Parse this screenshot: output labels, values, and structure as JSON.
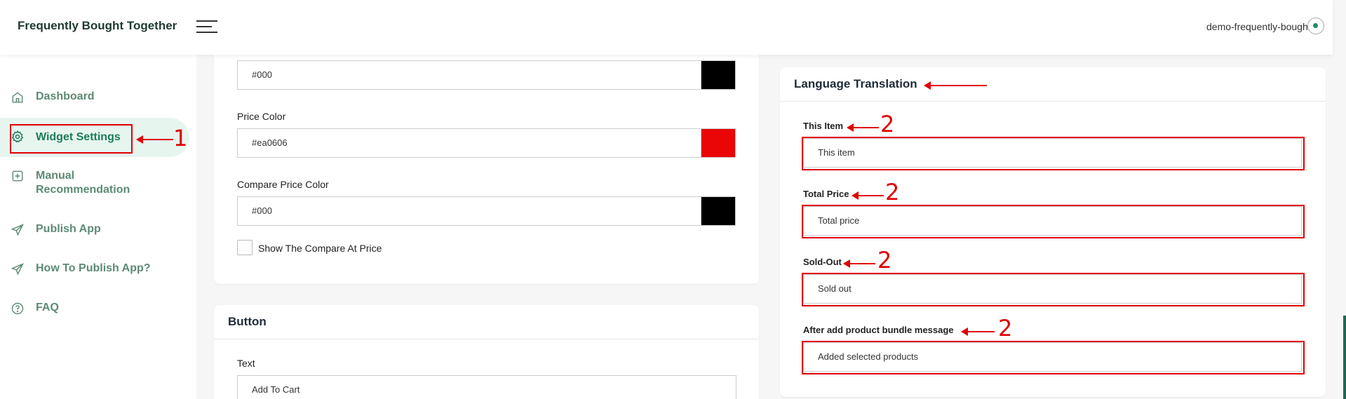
{
  "app": {
    "title": "Frequently Bought Together",
    "store": "demo-frequently-bought"
  },
  "sidebar": {
    "items": [
      {
        "label": "Dashboard",
        "icon": "home-icon"
      },
      {
        "label": "Widget Settings",
        "icon": "gear-icon"
      },
      {
        "label": "Manual Recommendation",
        "icon": "plus-square-icon"
      },
      {
        "label": "Publish App",
        "icon": "send-icon"
      },
      {
        "label": "How To Publish App?",
        "icon": "send-icon"
      },
      {
        "label": "FAQ",
        "icon": "question-circle-icon"
      }
    ]
  },
  "annotations": {
    "n1": "1",
    "n2": "2"
  },
  "colors_panel": {
    "top_value": "#000",
    "price_color_label": "Price Color",
    "price_color_value": "#ea0606",
    "compare_price_label": "Compare Price Color",
    "compare_price_value": "#000",
    "show_compare_label": "Show The Compare At Price",
    "swatch_colors": [
      "#000000",
      "#ea0606",
      "#000000"
    ]
  },
  "button_panel": {
    "title": "Button",
    "text_label": "Text",
    "text_value": "Add To Cart"
  },
  "language_panel": {
    "title": "Language Translation",
    "fields": [
      {
        "label": "This Item",
        "value": "This item"
      },
      {
        "label": "Total Price",
        "value": "Total price"
      },
      {
        "label": "Sold-Out",
        "value": "Sold out"
      },
      {
        "label": "After add product bundle message",
        "value": "Added selected products"
      }
    ]
  }
}
